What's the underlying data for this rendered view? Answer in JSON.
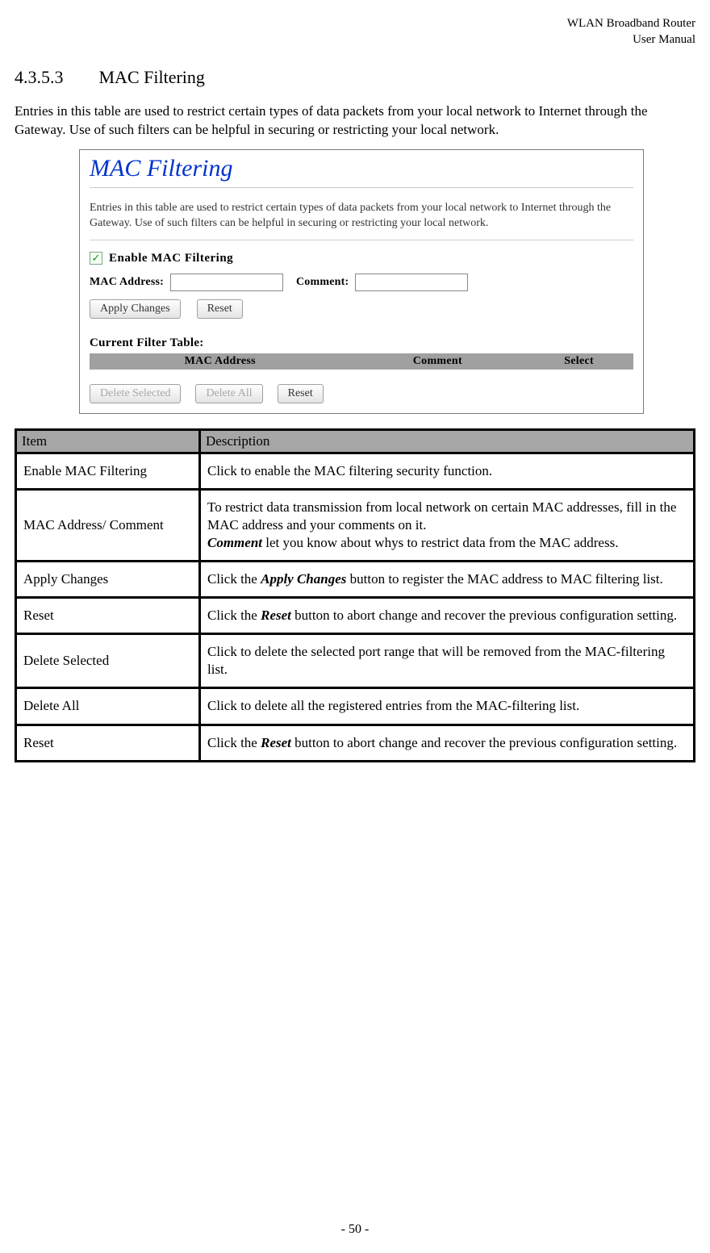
{
  "header": {
    "line1": "WLAN  Broadband  Router",
    "line2": "User  Manual"
  },
  "section": {
    "number": "4.3.5.3",
    "title": "MAC Filtering"
  },
  "intro": "Entries in this table are used to restrict certain types of data packets from your local network to Internet through the Gateway. Use of such filters can be helpful in securing or restricting your local network.",
  "screenshot": {
    "title": "MAC Filtering",
    "desc": "Entries in this table are used to restrict certain types of data packets from your local network to Internet through the Gateway. Use of such filters can be helpful in securing or restricting your local network.",
    "enable_label": "Enable MAC Filtering",
    "enable_checked": true,
    "mac_label": "MAC Address:",
    "mac_value": "",
    "comment_label": "Comment:",
    "comment_value": "",
    "apply_btn": "Apply Changes",
    "reset_btn": "Reset",
    "table_title": "Current Filter Table:",
    "cols": {
      "mac": "MAC Address",
      "comment": "Comment",
      "select": "Select"
    },
    "del_sel_btn": "Delete Selected",
    "del_all_btn": "Delete All",
    "reset2_btn": "Reset"
  },
  "desc_table": {
    "header": {
      "item": "Item",
      "desc": "Description"
    },
    "rows": [
      {
        "item": "Enable MAC Filtering",
        "desc_parts": [
          {
            "t": "Click to enable the MAC filtering security function."
          }
        ]
      },
      {
        "item": "MAC Address/ Comment",
        "desc_parts": [
          {
            "t": "To restrict data transmission from local network on certain MAC addresses, fill in the MAC address and your comments on it."
          },
          {
            "br": true
          },
          {
            "bi": "Comment"
          },
          {
            "t": " let you know about whys to restrict data from the MAC address."
          }
        ]
      },
      {
        "item": "Apply Changes",
        "desc_parts": [
          {
            "t": "Click the "
          },
          {
            "bi": "Apply Changes"
          },
          {
            "t": " button to register the MAC address to MAC filtering list."
          }
        ]
      },
      {
        "item": "Reset",
        "desc_parts": [
          {
            "t": "Click the "
          },
          {
            "bi": "Reset"
          },
          {
            "t": " button to abort change and recover the previous configuration setting."
          }
        ]
      },
      {
        "item": "Delete Selected",
        "desc_parts": [
          {
            "t": "Click to delete the selected port range that will be removed from the MAC-filtering list."
          }
        ]
      },
      {
        "item": "Delete All",
        "desc_parts": [
          {
            "t": "Click to delete all the registered entries from the MAC-filtering list."
          }
        ]
      },
      {
        "item": "Reset",
        "desc_parts": [
          {
            "t": "Click the "
          },
          {
            "bi": "Reset"
          },
          {
            "t": " button to abort change and recover the previous configuration setting."
          }
        ]
      }
    ]
  },
  "page_number": "- 50 -"
}
